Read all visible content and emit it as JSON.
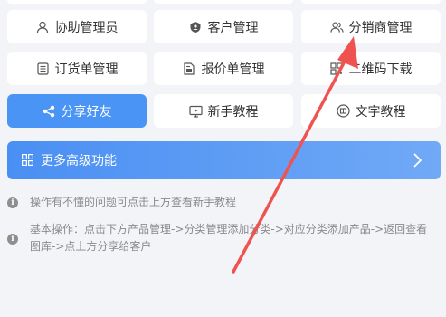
{
  "menu": {
    "row1": [
      {
        "label": "协助管理员",
        "icon": "user-icon"
      },
      {
        "label": "客户管理",
        "icon": "customer-shield-icon"
      },
      {
        "label": "分销商管理",
        "icon": "users-icon"
      }
    ],
    "row2": [
      {
        "label": "订货单管理",
        "icon": "order-list-icon"
      },
      {
        "label": "报价单管理",
        "icon": "quote-doc-icon"
      },
      {
        "label": "二维码下载",
        "icon": "qrcode-icon"
      }
    ],
    "row3": [
      {
        "label": "分享好友",
        "icon": "share-icon"
      },
      {
        "label": "新手教程",
        "icon": "monitor-icon"
      },
      {
        "label": "文字教程",
        "icon": "book-icon"
      }
    ]
  },
  "banner": {
    "label": "更多高级功能",
    "icon": "grid-icon",
    "chevron": "chevron-right-icon"
  },
  "notes": [
    "操作有不懂的问题可点击上方查看新手教程",
    "基本操作：点击下方产品管理->分类管理添加分类->对应分类添加产品->返回查看图库->点上方分享给客户"
  ],
  "colors": {
    "primary": "#4a94f5",
    "annotation_arrow": "#f0534f",
    "background": "#f3f4f8"
  }
}
